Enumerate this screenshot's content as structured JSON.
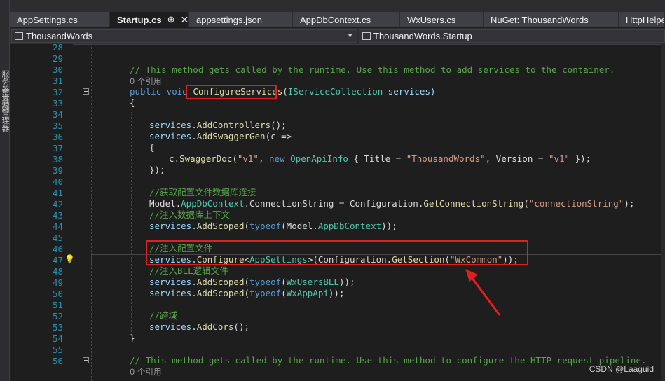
{
  "sidebar": {
    "panel1": "服务器资源管理器",
    "panel2": "工具箱"
  },
  "tabs": [
    {
      "label": "AppSettings.cs"
    },
    {
      "label": "Startup.cs",
      "pin": "⊕",
      "close": "✕"
    },
    {
      "label": "appsettings.json"
    },
    {
      "label": "AppDbContext.cs"
    },
    {
      "label": "WxUsers.cs"
    },
    {
      "label": "NuGet: ThousandWords"
    },
    {
      "label": "HttpHelper"
    }
  ],
  "nav": {
    "project": "ThousandWords",
    "type": "ThousandWords.Startup"
  },
  "line_numbers": [
    "28",
    "29",
    "30",
    "31",
    "32",
    "33",
    "34",
    "35",
    "36",
    "37",
    "38",
    "39",
    "40",
    "41",
    "42",
    "43",
    "44",
    "45",
    "46",
    "47",
    "48",
    "49",
    "50",
    "51",
    "52",
    "53",
    "54",
    "55",
    "56"
  ],
  "refs": {
    "r1": "0 个引用",
    "r2": "0 个引用"
  },
  "code": {
    "l30": "// This method gets called by the runtime. Use this method to add services to the container.",
    "l31_kw": "public void ",
    "l31_m": "ConfigureServices",
    "l31_p": "(",
    "l31_t": "IServiceCollection",
    "l31_v": " services)",
    "l32": "{",
    "l34a": "services.",
    "l34b": "AddControllers",
    "l34c": "();",
    "l35a": "services.",
    "l35b": "AddSwaggerGen",
    "l35c": "(c =>",
    "l36": "{",
    "l37a": "c.",
    "l37b": "SwaggerDoc",
    "l37c": "(",
    "l37d": "\"v1\"",
    "l37e": ", ",
    "l37f": "new ",
    "l37g": "OpenApiInfo",
    "l37h": " { Title = ",
    "l37i": "\"ThousandWords\"",
    "l37j": ", Version = ",
    "l37k": "\"v1\"",
    "l37l": " });",
    "l38": "});",
    "l40": "//获取配置文件数据库连接",
    "l41a": "Model.",
    "l41b": "AppDbContext",
    "l41c": ".ConnectionString = Configuration.",
    "l41d": "GetConnectionString",
    "l41e": "(",
    "l41f": "\"connectionString\"",
    "l41g": ");",
    "l42": "//注入数据库上下文",
    "l43a": "services.",
    "l43b": "AddScoped",
    "l43c": "(",
    "l43d": "typeof",
    "l43e": "(Model.",
    "l43f": "AppDbContext",
    "l43g": "));",
    "l45": "//注入配置文件",
    "l46a": "services.",
    "l46b": "Configure",
    "l46c": "<",
    "l46d": "AppSettings",
    "l46e": ">(Configuration.",
    "l46f": "GetSection",
    "l46g": "(",
    "l46h": "\"WxCommon\"",
    "l46i": "));",
    "l47": "//注入BLL逻辑文件",
    "l48a": "services.",
    "l48b": "AddScoped",
    "l48c": "(",
    "l48d": "typeof",
    "l48e": "(",
    "l48f": "WxUsersBLL",
    "l48g": "));",
    "l49a": "services.",
    "l49b": "AddScoped",
    "l49c": "(",
    "l49d": "typeof",
    "l49e": "(",
    "l49f": "WxAppApi",
    "l49g": "));",
    "l51": "//跨域",
    "l52a": "services.",
    "l52b": "AddCors",
    "l52c": "();",
    "l53": "}",
    "l55": "// This method gets called by the runtime. Use this method to configure the HTTP request pipeline."
  },
  "watermark": "CSDN @Laaguid",
  "colors": {
    "annotation": "#e0201f",
    "comment": "#57a64a",
    "keyword": "#569cd6",
    "type": "#4ec9b0",
    "method": "#dcdcaa",
    "string": "#d69d85"
  }
}
